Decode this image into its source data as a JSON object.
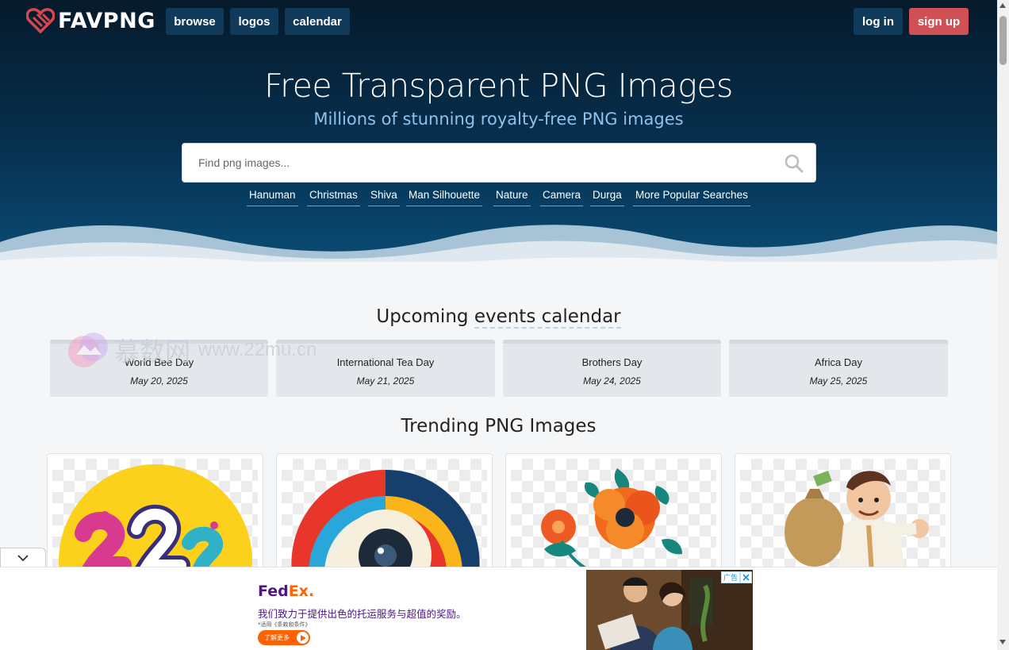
{
  "header": {
    "logo_text": "FAVPNG",
    "nav": [
      {
        "label": "browse"
      },
      {
        "label": "logos"
      },
      {
        "label": "calendar"
      }
    ],
    "login_label": "log in",
    "signup_label": "sign up"
  },
  "hero": {
    "title": "Free Transparent PNG Images",
    "subtitle": "Millions of stunning royalty-free PNG images",
    "search_placeholder": "Find png images...",
    "popular_searches": [
      "Hanuman",
      "Christmas",
      "Shiva",
      "Man Silhouette",
      "Nature",
      "Camera",
      "Durga",
      "More Popular Searches"
    ]
  },
  "events": {
    "title_prefix": "Upcoming ",
    "title_emph": "events calendar",
    "items": [
      {
        "name": "World Bee Day",
        "date": "May 20, 2025"
      },
      {
        "name": "International Tea Day",
        "date": "May 21, 2025"
      },
      {
        "name": "Brothers Day",
        "date": "May 24, 2025"
      },
      {
        "name": "Africa Day",
        "date": "May 25, 2025"
      }
    ]
  },
  "watermark": {
    "cn": "慕数网",
    "url": "www.22mu.cn"
  },
  "trending": {
    "title": "Trending PNG Images"
  },
  "ad": {
    "brand_fed": "Fed",
    "brand_ex": "Ex",
    "brand_dot": ".",
    "headline": "我们致力于提供出色的托运服务与超值的奖励。",
    "fine_print": "*适用《条款和条件》",
    "cta": "了解更多",
    "tag": "广告"
  },
  "colors": {
    "accent": "#cf5156",
    "nav_bg": "#0f3a5a",
    "hero_top": "#061a2b",
    "hero_bottom": "#0a4b74",
    "subtitle": "#8fc2ea"
  }
}
